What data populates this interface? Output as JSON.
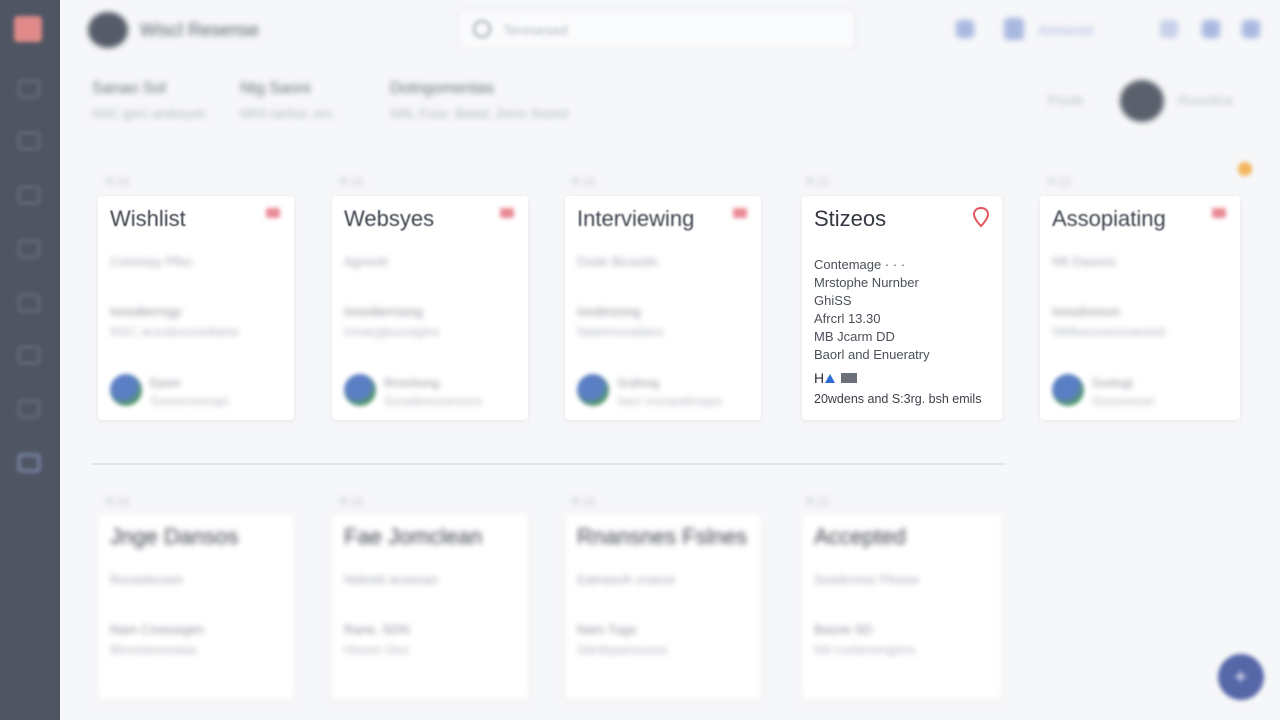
{
  "app": {
    "title": "Wiscl Resense"
  },
  "search": {
    "placeholder": "Teresesed"
  },
  "header": {
    "user_label": "Aresenst"
  },
  "summary": {
    "items": [
      {
        "title": "Sanao Sol",
        "sub": "NSC gerc-andosyel"
      },
      {
        "title": "Ntg Saoni",
        "sub": "NR3 ranhor, ero"
      },
      {
        "title": "Dotngomentas",
        "sub": "NRL Fuse. Balad. Zeror Snoed"
      }
    ],
    "share_label": "Poole",
    "profile_label": "Rouotice"
  },
  "columns_row1": [
    {
      "tag": "R.12",
      "title": "Wishlist",
      "line1": "Csmorpy Pllsc",
      "line2": "Iooodierrsgy",
      "line3": "NSC acsolpoossdtane",
      "name1": "Epsm",
      "name2": "Sueseroesngic"
    },
    {
      "tag": "R.12",
      "title": "Websyes",
      "line1": "Agnesh",
      "line2": "Iooodierrssng",
      "line3": "Irmarglpuosigins",
      "name1": "Rmmhong",
      "name2": "Sucadeoosanssos"
    },
    {
      "tag": "R.12",
      "title": "Interviewing",
      "line1": "Dode Bicasdo",
      "line2": "Ioodmzsng",
      "line3": "Nalemonadanc",
      "name1": "Srafnog",
      "name2": "Sacr onsopalinngas"
    },
    {
      "tag": "R.12",
      "title": "Stizeos",
      "lines": [
        "Contemage · · ·",
        "Mrstophe Nurnber",
        "GhiSS",
        "Afrcrl 13.30",
        "MB Jcarm DD",
        "Baorl and Enueratry"
      ],
      "icons_text": "H",
      "foot": "20wdens and S:3rg. bsh emils"
    },
    {
      "tag": "R.12",
      "title": "Assopiating",
      "line1": "Nft Daseos",
      "line2": "Iooodnoson",
      "line3": "NMleeussesoaoasit",
      "name1": "Sostngt",
      "name2": "Sossoesoei"
    }
  ],
  "columns_row2": [
    {
      "tag": "R.12",
      "title": "Jnge Dansos",
      "line1": "Rorasleusen",
      "line2": "Nam Cmesegen",
      "line3": "Btrestanseaiaa"
    },
    {
      "tag": "R.12",
      "title": "Fae Jomclean",
      "line1": "Nidretit ansesan",
      "line2": "Rane, SDN",
      "line3": "Heson Ges"
    },
    {
      "tag": "R.12",
      "title": "Rnansnes Fslnes",
      "line1": "Eatnasoh cnanut",
      "line2": "Nam Tugs",
      "line3": "Sdrdepansooss"
    },
    {
      "tag": "R.12",
      "title": "Accepted",
      "line1": "Sosdcnnor Flnoce",
      "line2": "Basne SD",
      "line3": "Nd conterwngens"
    }
  ],
  "colors": {
    "sidebar": "#4f5563",
    "accent": "#5667a8",
    "flag": "#e98a95",
    "pin": "#e2565a"
  }
}
